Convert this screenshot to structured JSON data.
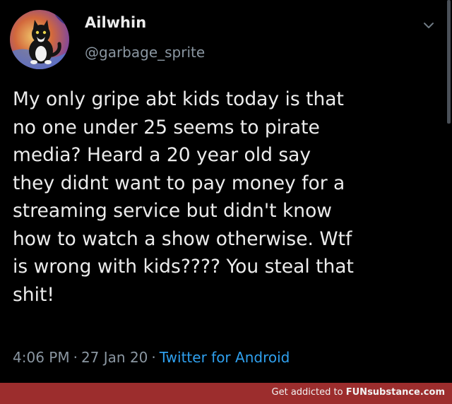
{
  "tweet": {
    "display_name": "Ailwhin",
    "handle": "@garbage_sprite",
    "text": "My only gripe abt kids today is that\nno one under 25 seems to pirate\nmedia? Heard a 20 year old say\nthey didnt want to pay money for a\nstreaming service but didn't know\nhow to watch a show otherwise. Wtf\nis wrong with kids???? You steal that\nshit!",
    "time": "4:06 PM",
    "date": "27 Jan 20",
    "source": "Twitter for Android",
    "separator": "·"
  },
  "icons": {
    "menu": "chevron-down-icon",
    "avatar": "cat-avatar"
  },
  "watermark": {
    "prefix": "Get addicted to ",
    "brand_fun": "FUN",
    "brand_rest": "substance.com"
  },
  "colors": {
    "background": "#000000",
    "text": "#ececec",
    "secondary": "#8a96a1",
    "link": "#2fa0ee",
    "footer": "#9c2d2d"
  }
}
